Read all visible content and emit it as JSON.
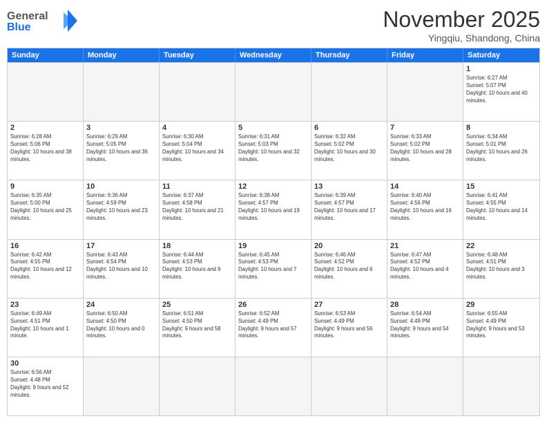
{
  "header": {
    "logo_general": "General",
    "logo_blue": "Blue",
    "month_title": "November 2025",
    "subtitle": "Yingqiu, Shandong, China"
  },
  "weekdays": [
    "Sunday",
    "Monday",
    "Tuesday",
    "Wednesday",
    "Thursday",
    "Friday",
    "Saturday"
  ],
  "rows": [
    [
      {
        "day": "",
        "empty": true
      },
      {
        "day": "",
        "empty": true
      },
      {
        "day": "",
        "empty": true
      },
      {
        "day": "",
        "empty": true
      },
      {
        "day": "",
        "empty": true
      },
      {
        "day": "",
        "empty": true
      },
      {
        "day": "1",
        "sunrise": "6:27 AM",
        "sunset": "5:07 PM",
        "daylight": "10 hours and 40 minutes."
      }
    ],
    [
      {
        "day": "2",
        "sunrise": "6:28 AM",
        "sunset": "5:06 PM",
        "daylight": "10 hours and 38 minutes."
      },
      {
        "day": "3",
        "sunrise": "6:29 AM",
        "sunset": "5:05 PM",
        "daylight": "10 hours and 36 minutes."
      },
      {
        "day": "4",
        "sunrise": "6:30 AM",
        "sunset": "5:04 PM",
        "daylight": "10 hours and 34 minutes."
      },
      {
        "day": "5",
        "sunrise": "6:31 AM",
        "sunset": "5:03 PM",
        "daylight": "10 hours and 32 minutes."
      },
      {
        "day": "6",
        "sunrise": "6:32 AM",
        "sunset": "5:02 PM",
        "daylight": "10 hours and 30 minutes."
      },
      {
        "day": "7",
        "sunrise": "6:33 AM",
        "sunset": "5:02 PM",
        "daylight": "10 hours and 28 minutes."
      },
      {
        "day": "8",
        "sunrise": "6:34 AM",
        "sunset": "5:01 PM",
        "daylight": "10 hours and 26 minutes."
      }
    ],
    [
      {
        "day": "9",
        "sunrise": "6:35 AM",
        "sunset": "5:00 PM",
        "daylight": "10 hours and 25 minutes."
      },
      {
        "day": "10",
        "sunrise": "6:36 AM",
        "sunset": "4:59 PM",
        "daylight": "10 hours and 23 minutes."
      },
      {
        "day": "11",
        "sunrise": "6:37 AM",
        "sunset": "4:58 PM",
        "daylight": "10 hours and 21 minutes."
      },
      {
        "day": "12",
        "sunrise": "6:38 AM",
        "sunset": "4:57 PM",
        "daylight": "10 hours and 19 minutes."
      },
      {
        "day": "13",
        "sunrise": "6:39 AM",
        "sunset": "4:57 PM",
        "daylight": "10 hours and 17 minutes."
      },
      {
        "day": "14",
        "sunrise": "6:40 AM",
        "sunset": "4:56 PM",
        "daylight": "10 hours and 16 minutes."
      },
      {
        "day": "15",
        "sunrise": "6:41 AM",
        "sunset": "4:55 PM",
        "daylight": "10 hours and 14 minutes."
      }
    ],
    [
      {
        "day": "16",
        "sunrise": "6:42 AM",
        "sunset": "4:55 PM",
        "daylight": "10 hours and 12 minutes."
      },
      {
        "day": "17",
        "sunrise": "6:43 AM",
        "sunset": "4:54 PM",
        "daylight": "10 hours and 10 minutes."
      },
      {
        "day": "18",
        "sunrise": "6:44 AM",
        "sunset": "4:53 PM",
        "daylight": "10 hours and 9 minutes."
      },
      {
        "day": "19",
        "sunrise": "6:45 AM",
        "sunset": "4:53 PM",
        "daylight": "10 hours and 7 minutes."
      },
      {
        "day": "20",
        "sunrise": "6:46 AM",
        "sunset": "4:52 PM",
        "daylight": "10 hours and 6 minutes."
      },
      {
        "day": "21",
        "sunrise": "6:47 AM",
        "sunset": "4:52 PM",
        "daylight": "10 hours and 4 minutes."
      },
      {
        "day": "22",
        "sunrise": "6:48 AM",
        "sunset": "4:51 PM",
        "daylight": "10 hours and 3 minutes."
      }
    ],
    [
      {
        "day": "23",
        "sunrise": "6:49 AM",
        "sunset": "4:51 PM",
        "daylight": "10 hours and 1 minute."
      },
      {
        "day": "24",
        "sunrise": "6:50 AM",
        "sunset": "4:50 PM",
        "daylight": "10 hours and 0 minutes."
      },
      {
        "day": "25",
        "sunrise": "6:51 AM",
        "sunset": "4:50 PM",
        "daylight": "9 hours and 58 minutes."
      },
      {
        "day": "26",
        "sunrise": "6:52 AM",
        "sunset": "4:49 PM",
        "daylight": "9 hours and 57 minutes."
      },
      {
        "day": "27",
        "sunrise": "6:53 AM",
        "sunset": "4:49 PM",
        "daylight": "9 hours and 56 minutes."
      },
      {
        "day": "28",
        "sunrise": "6:54 AM",
        "sunset": "4:49 PM",
        "daylight": "9 hours and 54 minutes."
      },
      {
        "day": "29",
        "sunrise": "6:55 AM",
        "sunset": "4:49 PM",
        "daylight": "9 hours and 53 minutes."
      }
    ],
    [
      {
        "day": "30",
        "sunrise": "6:56 AM",
        "sunset": "4:48 PM",
        "daylight": "9 hours and 52 minutes."
      },
      {
        "day": "",
        "empty": true
      },
      {
        "day": "",
        "empty": true
      },
      {
        "day": "",
        "empty": true
      },
      {
        "day": "",
        "empty": true
      },
      {
        "day": "",
        "empty": true
      },
      {
        "day": "",
        "empty": true
      }
    ]
  ]
}
